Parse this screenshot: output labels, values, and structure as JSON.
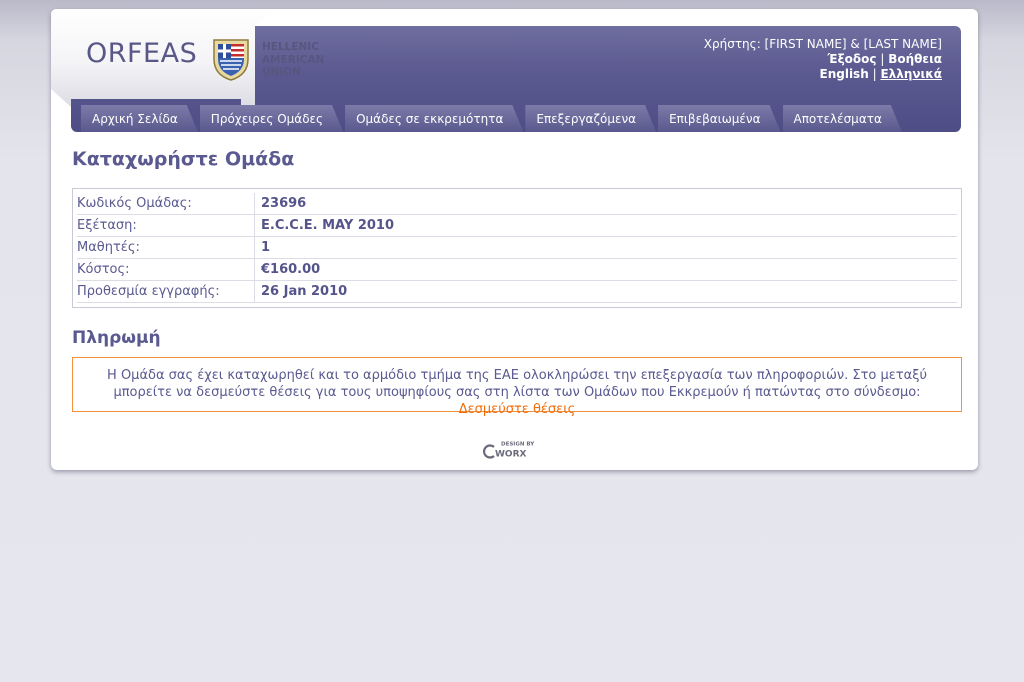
{
  "header": {
    "brand": "ORFEAS",
    "org_lines": [
      "HELLENIC",
      "AMERICAN",
      "UNION"
    ],
    "user_label": "Χρήστης: [FIRST NAME] & [LAST NAME]",
    "logout": "Έξοδος",
    "separator": "|",
    "help": "Βοήθεια",
    "lang_en": "English",
    "lang_el": "Ελληνικά"
  },
  "nav": {
    "tabs": [
      {
        "label": "Αρχική Σελίδα"
      },
      {
        "label": "Πρόχειρες Ομάδες"
      },
      {
        "label": "Ομάδες σε εκκρεμότητα"
      },
      {
        "label": "Επεξεργαζόμενα"
      },
      {
        "label": "Επιβεβαιωμένα"
      },
      {
        "label": "Αποτελέσματα"
      }
    ]
  },
  "main": {
    "title": "Καταχωρήστε Ομάδα",
    "details": [
      {
        "label": "Κωδικός Ομάδας:",
        "value": "23696"
      },
      {
        "label": "Εξέταση:",
        "value": "E.C.C.E. MAY 2010"
      },
      {
        "label": "Μαθητές:",
        "value": "1"
      },
      {
        "label": "Κόστος:",
        "value": "€160.00"
      },
      {
        "label": "Προθεσμία εγγραφής:",
        "value": "26 Jan 2010"
      }
    ],
    "payment_title": "Πληρωμή",
    "payment_text": "Η Ομάδα σας έχει καταχωρηθεί και το αρμόδιο τμήμα της ΕΑΕ ολοκληρώσει την επεξεργασία των πληροφοριών. Στο μεταξύ μπορείτε να δεσμεύστε θέσεις για τους υποψηφίους σας στη λίστα των Ομάδων που Εκκρεμούν ή πατώντας στο σύνδεσμο: ",
    "payment_link": "Δεσμεύστε θέσεις"
  },
  "footer": {
    "design_by": "DESIGN BY",
    "brand": "WORX"
  },
  "colors": {
    "banner": "#5a5990",
    "text": "#5a5990",
    "accent": "#f06c0a"
  }
}
